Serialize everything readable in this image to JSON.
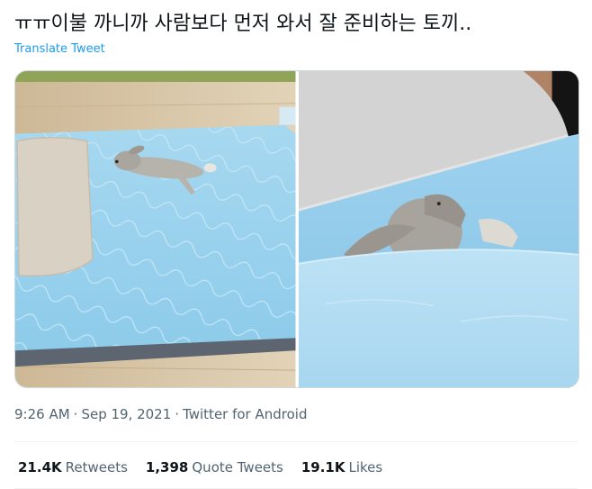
{
  "tweet": {
    "text": "ㅠㅠ이불 까니까 사람보다 먼저 와서 잘 준비하는 토끼..",
    "translate_label": "Translate Tweet"
  },
  "media": {
    "photos": [
      {
        "name": "photo-rabbit-on-mattress"
      },
      {
        "name": "photo-rabbit-under-blanket"
      }
    ]
  },
  "meta": {
    "time": "9:26 AM",
    "separator": "·",
    "date": "Sep 19, 2021",
    "source": "Twitter for Android"
  },
  "stats": {
    "retweets_count": "21.4K",
    "retweets_label": "Retweets",
    "quotes_count": "1,398",
    "quotes_label": "Quote Tweets",
    "likes_count": "19.1K",
    "likes_label": "Likes"
  },
  "colors": {
    "link": "#1d9bf0",
    "secondary_text": "#536471",
    "primary_text": "#0f1419",
    "mattress_blue": "#9cd3ee"
  }
}
